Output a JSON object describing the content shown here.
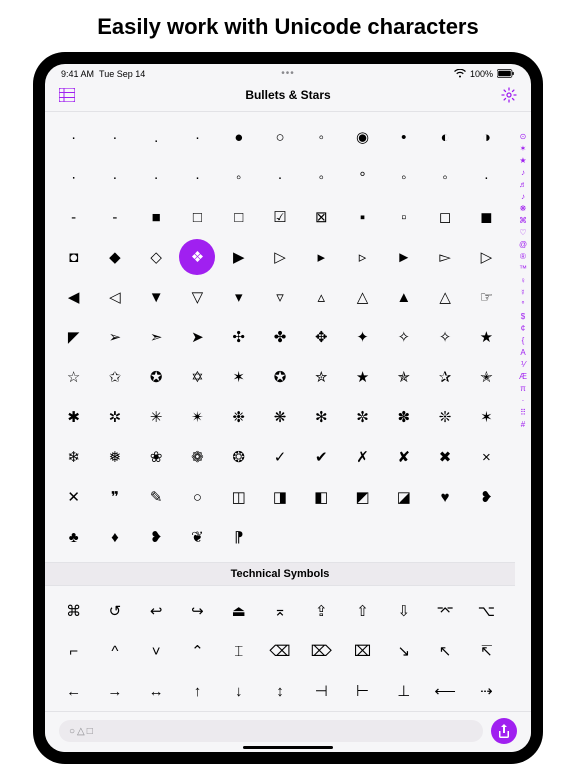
{
  "headline": "Easily work with Unicode characters",
  "accent": "#a020f0",
  "status": {
    "time": "9:41 AM",
    "date": "Tue Sep 14",
    "center": "•••",
    "wifi": "wifi-icon",
    "battery_pct": "100%",
    "battery_icon": "battery-full-icon"
  },
  "nav": {
    "left_icon": "list-icon",
    "title": "Bullets & Stars",
    "right_icon": "gear-icon"
  },
  "sections": [
    {
      "title": "Bullets & Stars",
      "show_header": false,
      "selected_index": 36,
      "chars": [
        "·",
        "·",
        ".",
        "·",
        "●",
        "○",
        "◦",
        "◉",
        "•",
        "◐",
        "◑",
        "∙",
        "·",
        "·",
        "·",
        "◦",
        "·",
        "◦",
        "°",
        "◦",
        "◦",
        "·",
        "-",
        "-",
        "■",
        "□",
        "□",
        "☑",
        "⊠",
        "▪",
        "▫",
        "◻",
        "◼",
        "◘",
        "◆",
        "◇",
        "❖",
        "▶",
        "▷",
        "▸",
        "▹",
        "►",
        "▻",
        "▷",
        "◀",
        "◁",
        "▼",
        "▽",
        "▾",
        "▿",
        "▵",
        "△",
        "▲",
        "△",
        "☞",
        "◤",
        "➢",
        "➣",
        "➤",
        "✣",
        "✤",
        "✥",
        "✦",
        "✧",
        "✧",
        "★",
        "☆",
        "✩",
        "✪",
        "✡",
        "✶",
        "✪",
        "✮",
        "★",
        "✯",
        "✰",
        "✭",
        "✱",
        "✲",
        "✳",
        "✴",
        "❉",
        "❋",
        "✻",
        "✼",
        "✽",
        "❊",
        "✶",
        "❄",
        "❅",
        "❀",
        "❁",
        "❂",
        "✓",
        "✔",
        "✗",
        "✘",
        "✖",
        "×",
        "✕",
        "❞",
        "✎",
        "○",
        "◫",
        "◨",
        "◧",
        "◩",
        "◪",
        "♥",
        "❥",
        "♣",
        "♦",
        "❥",
        "❦",
        "⁋",
        "",
        "",
        "",
        "",
        "",
        ""
      ]
    },
    {
      "title": "Technical Symbols",
      "show_header": true,
      "selected_index": -1,
      "chars": [
        "⌘",
        "↺",
        "↩",
        "↪",
        "⏏",
        "⌅",
        "⇪",
        "⇧",
        "⇩",
        "⌤",
        "⌥",
        "⌐",
        "^",
        "˅",
        "⌃",
        "⌶",
        "⌫",
        "⌦",
        "⌧",
        "↘",
        "↖",
        "↸",
        "←",
        "→",
        "↔",
        "↑",
        "↓",
        "↕",
        "⊣",
        "⊢",
        "⊥",
        "⟵",
        "⇢"
      ]
    }
  ],
  "index_bar": [
    "⊙",
    "✶",
    "★",
    "♪",
    "♬",
    "♪",
    "❋",
    "⌘",
    "♡",
    "@",
    "®",
    "™",
    "♀",
    "☿",
    "°",
    "$",
    "¢",
    "{",
    "A",
    "⅟",
    "Æ",
    "π",
    "·",
    "⠿",
    "#"
  ],
  "bottom": {
    "search_placeholder": "○△□",
    "share_icon": "share-icon"
  }
}
